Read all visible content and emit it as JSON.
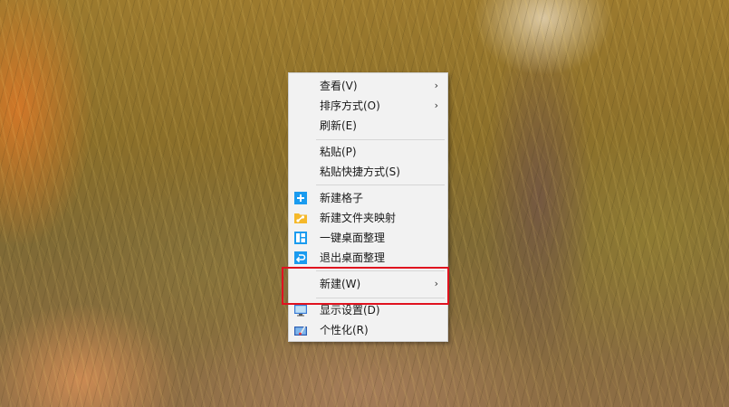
{
  "menu": {
    "items": [
      {
        "id": "view",
        "label": "查看(V)",
        "submenu_arrow": "›"
      },
      {
        "id": "sort",
        "label": "排序方式(O)",
        "submenu_arrow": "›"
      },
      {
        "id": "refresh",
        "label": "刷新(E)"
      },
      {
        "id": "paste",
        "label": "粘贴(P)"
      },
      {
        "id": "paste-shortcut",
        "label": "粘贴快捷方式(S)"
      },
      {
        "id": "new-grid",
        "label": "新建格子",
        "icon": "plus-square-icon"
      },
      {
        "id": "new-folder-map",
        "label": "新建文件夹映射",
        "icon": "folder-link-icon"
      },
      {
        "id": "one-click-organize",
        "label": "一键桌面整理",
        "icon": "layout-grid-icon"
      },
      {
        "id": "exit-organize",
        "label": "退出桌面整理",
        "icon": "return-arrow-icon"
      },
      {
        "id": "new",
        "label": "新建(W)",
        "submenu_arrow": "›"
      },
      {
        "id": "display-settings",
        "label": "显示设置(D)",
        "icon": "monitor-icon"
      },
      {
        "id": "personalize",
        "label": "个性化(R)",
        "icon": "personalize-icon"
      }
    ]
  },
  "colors": {
    "menu_background": "#f2f2f2",
    "highlight_border": "#e0121f",
    "icon_blue": "#1a9bef",
    "icon_folder": "#f5b829"
  }
}
